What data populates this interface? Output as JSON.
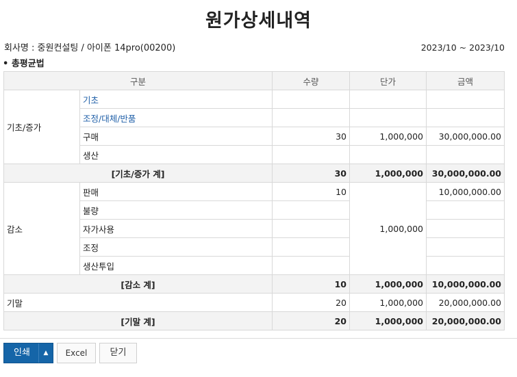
{
  "title": "원가상세내역",
  "company_info": "회사명 : 중원컨설팅 / 아이폰 14pro(00200)",
  "period": "2023/10 ~ 2023/10",
  "method": "• 총평균법",
  "headers": {
    "category": "구분",
    "qty": "수량",
    "unit_price": "단가",
    "amount": "금액"
  },
  "increase": {
    "label": "기초/증가",
    "rows": [
      {
        "name": "기초",
        "qty": "",
        "price": "",
        "amount": ""
      },
      {
        "name": "조정/대체/반품",
        "qty": "",
        "price": "",
        "amount": ""
      },
      {
        "name": "구매",
        "qty": "30",
        "price": "1,000,000",
        "amount": "30,000,000.00"
      },
      {
        "name": "생산",
        "qty": "",
        "price": "",
        "amount": ""
      }
    ],
    "subtotal": {
      "label": "[기초/증가 계]",
      "qty": "30",
      "price": "1,000,000",
      "amount": "30,000,000.00"
    }
  },
  "decrease": {
    "label": "감소",
    "price": "1,000,000",
    "rows": [
      {
        "name": "판매",
        "qty": "10",
        "amount": "10,000,000.00"
      },
      {
        "name": "불량",
        "qty": "",
        "amount": ""
      },
      {
        "name": "자가사용",
        "qty": "",
        "amount": ""
      },
      {
        "name": "조정",
        "qty": "",
        "amount": ""
      },
      {
        "name": "생산투입",
        "qty": "",
        "amount": ""
      }
    ],
    "subtotal": {
      "label": "[감소 계]",
      "qty": "10",
      "price": "1,000,000",
      "amount": "10,000,000.00"
    }
  },
  "ending": {
    "label": "기말",
    "qty": "20",
    "price": "1,000,000",
    "amount": "20,000,000.00"
  },
  "ending_total": {
    "label": "[기말 계]",
    "qty": "20",
    "price": "1,000,000",
    "amount": "20,000,000.00"
  },
  "buttons": {
    "print": "인쇄",
    "print_menu": "▲",
    "excel": "Excel",
    "close": "닫기"
  },
  "colors": {
    "primary_button": "#1565a8",
    "link_text": "#1f5fa8",
    "header_bg": "#f3f3f3"
  }
}
